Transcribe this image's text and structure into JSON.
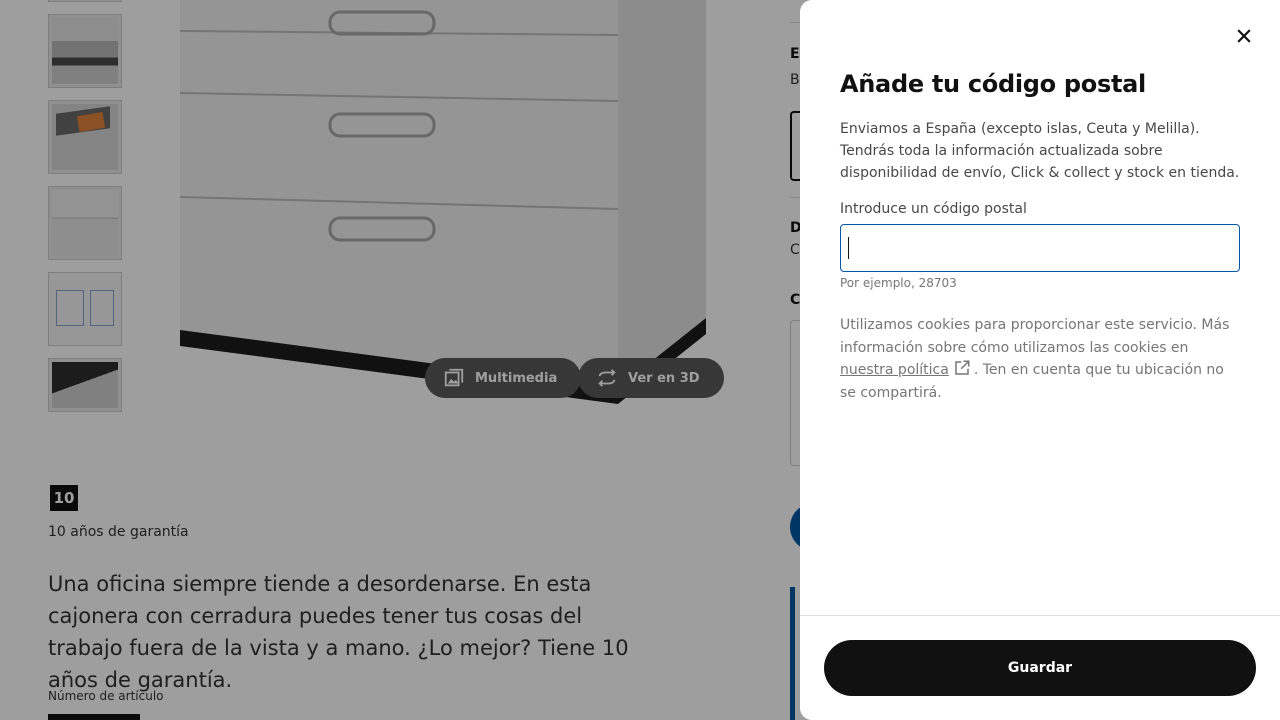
{
  "product": {
    "warranty_badge": "10",
    "warranty_text": "10 años de garantía",
    "description": "Una oficina siempre tiende a desordenarse. En esta cajonera con cerradura puedes tener tus cosas del trabajo fuera de la vista y a mano. ¿Lo mejor? Tiene 10 años de garantía.",
    "article_number_label": "Número de artículo",
    "media_buttons": {
      "multimedia": "Multimedia",
      "view_3d": "Ver en 3D"
    }
  },
  "right_column": {
    "section_1_initial": "El",
    "section_1_sub": "B",
    "section_2_initial": "D",
    "section_2_sub": "C",
    "section_3_initial": "C"
  },
  "postal_modal": {
    "title": "Añade tu código postal",
    "body": "Enviamos a España (excepto islas, Ceuta y Melilla). Tendrás toda la información actualizada sobre disponibilidad de envío, Click & collect y stock en tienda.",
    "input_label": "Introduce un código postal",
    "input_value": "",
    "input_hint": "Por ejemplo, 28703",
    "cookie_text_before": "Utilizamos cookies para proporcionar este servicio. Más información sobre cómo utilizamos las cookies en",
    "cookie_link": "nuestra política",
    "cookie_text_after": ". Ten en cuenta que tu ubicación no se compartirá.",
    "save_label": "Guardar"
  },
  "icons": {
    "close": "close-icon",
    "external_link": "external-link-icon",
    "gallery": "gallery-icon",
    "rotate_3d": "rotate-3d-icon"
  },
  "colors": {
    "accent_blue": "#0058a3",
    "button_dark": "#111111",
    "text_muted": "#767676"
  }
}
